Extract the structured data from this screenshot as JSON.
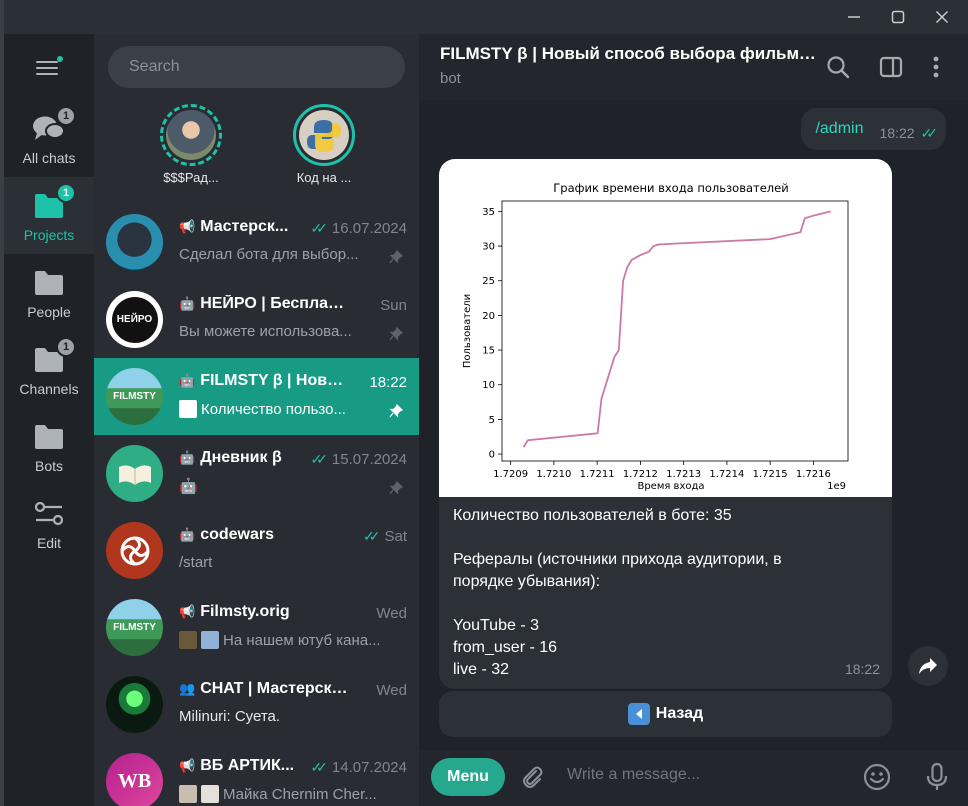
{
  "window": {
    "minimize_icon": "minimize-icon",
    "maximize_icon": "maximize-icon",
    "close_icon": "close-icon"
  },
  "folders": [
    {
      "label": "All chats",
      "badge": "1",
      "icon": "chat-bubbles-icon"
    },
    {
      "label": "Projects",
      "badge": "1",
      "icon": "folder-icon",
      "active": true
    },
    {
      "label": "People",
      "badge": "",
      "icon": "folder-icon"
    },
    {
      "label": "Channels",
      "badge": "1",
      "icon": "folder-icon"
    },
    {
      "label": "Bots",
      "badge": "",
      "icon": "folder-icon"
    },
    {
      "label": "Edit",
      "badge": "",
      "icon": "sliders-icon"
    }
  ],
  "search": {
    "placeholder": "Search"
  },
  "stories": [
    {
      "name": "$$$Рад..."
    },
    {
      "name": "Код на ..."
    }
  ],
  "chats": [
    {
      "type_icon": "📢",
      "name": "Мастерск...",
      "time": "16.07.2024",
      "read": true,
      "preview": "Сделал бота для выбор...",
      "pinned": true
    },
    {
      "type_icon": "🤖",
      "name": "НЕЙРО | Бесплатн...",
      "time": "Sun",
      "read": false,
      "preview": "Вы можете использова...",
      "pinned": true
    },
    {
      "type_icon": "🤖",
      "name": "FILMSTY β | Новы...",
      "time": "18:22",
      "read": false,
      "preview": "Количество пользо...",
      "pinned": true,
      "active": true
    },
    {
      "type_icon": "🤖",
      "name": "Дневник β",
      "time": "15.07.2024",
      "read": true,
      "preview": "🤖",
      "pinned": true
    },
    {
      "type_icon": "🤖",
      "name": "codewars",
      "time": "Sat",
      "read": true,
      "preview": "/start",
      "pinned": false
    },
    {
      "type_icon": "📢",
      "name": "Filmsty.orig",
      "time": "Wed",
      "read": false,
      "preview": "На нашем ютуб кана...",
      "pinned": false
    },
    {
      "type_icon": "👥",
      "name": "CHAT | Мастерска...",
      "time": "Wed",
      "read": false,
      "preview": "Milinuri: Суета.",
      "pinned": false
    },
    {
      "type_icon": "📢",
      "name": "ВБ АРТИК...",
      "time": "14.07.2024",
      "read": true,
      "preview": "Майка Chernim Cher...",
      "pinned": false
    }
  ],
  "chat": {
    "title": "FILMSTY β | Новый способ выбора фильмов...",
    "subtitle": "bot",
    "out_message": {
      "text": "/admin",
      "time": "18:22"
    },
    "in_message": {
      "time": "18:22",
      "lines": [
        "Количество пользователей в боте: 35",
        "",
        "Рефералы (источники прихода аудитории, в",
        "порядке убывания):",
        "",
        "YouTube - 3",
        "from_user - 16",
        "live - 32"
      ]
    },
    "inline_button": "Назад",
    "composer": {
      "menu": "Menu",
      "placeholder": "Write a message..."
    }
  },
  "chart_data": {
    "type": "line",
    "title": "График времени входа пользователей",
    "xlabel": "Время входа",
    "ylabel": "Пользователи",
    "x_offset_label": "1e9",
    "xlim": [
      1.72088,
      1.72168
    ],
    "ylim": [
      -1,
      36.5
    ],
    "x_ticks": [
      "1.7209",
      "1.7210",
      "1.7211",
      "1.7212",
      "1.7213",
      "1.7214",
      "1.7215",
      "1.7216"
    ],
    "y_ticks": [
      "0",
      "5",
      "10",
      "15",
      "20",
      "25",
      "30",
      "35"
    ],
    "color": "#cc79a7",
    "x": [
      1.72093,
      1.72094,
      1.721101,
      1.72111,
      1.72112,
      1.72114,
      1.72115,
      1.72116,
      1.72117,
      1.72118,
      1.7212,
      1.72122,
      1.72123,
      1.72124,
      1.72126,
      1.7215,
      1.72157,
      1.72158,
      1.7216,
      1.72164
    ],
    "y": [
      1,
      2,
      3,
      8,
      10,
      14,
      15,
      25,
      27,
      28,
      28.7,
      29.2,
      30,
      30.2,
      30.3,
      31,
      32,
      34,
      34.4,
      35
    ]
  }
}
